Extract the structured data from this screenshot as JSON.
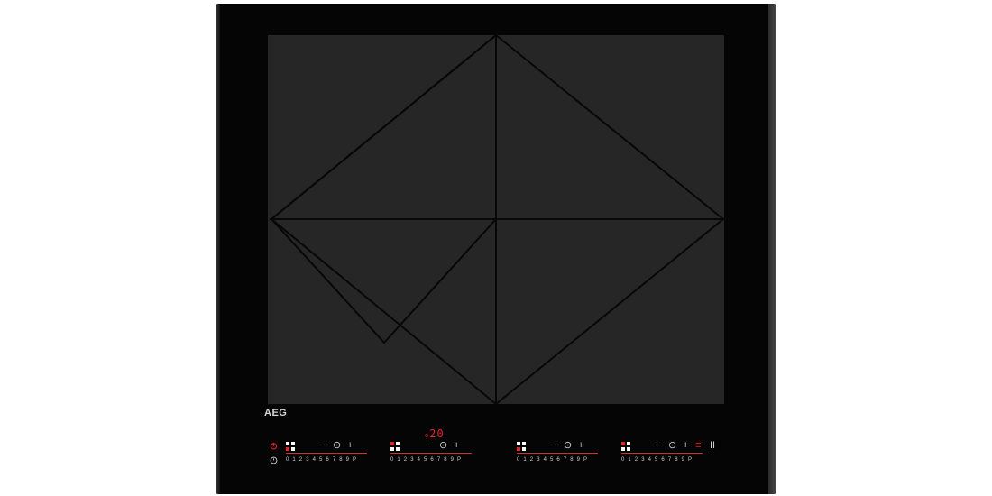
{
  "brand": "AEG",
  "display": {
    "prefix": "o",
    "value": "20"
  },
  "controls": {
    "minus": "−",
    "plus": "+",
    "timer": "⊙",
    "pause": "II",
    "bridge": "≡"
  },
  "slider": {
    "levels": "0 1 2 3 4 5 6 7 8 9 P"
  },
  "colors": {
    "frame": "#050505",
    "glass": "#262626",
    "accent": "#e0262a",
    "rim": "#4a4a4a"
  },
  "icons": {
    "power": "power-icon",
    "lock": "lock-icon",
    "timer": "timer-icon",
    "cooking-zone": "cooking-zone-icon"
  }
}
